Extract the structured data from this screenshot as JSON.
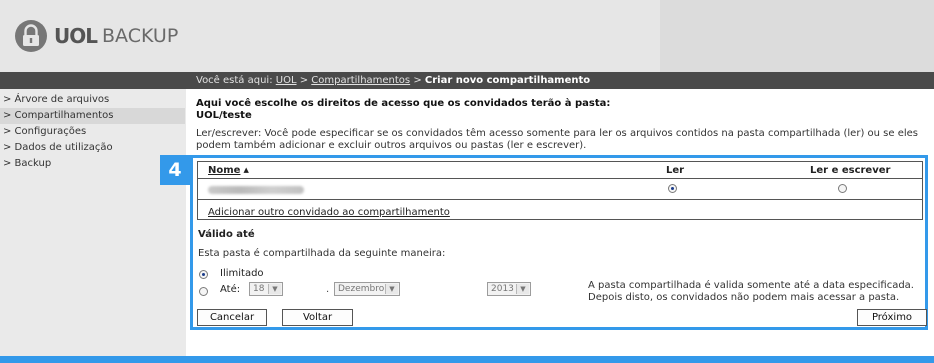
{
  "header": {
    "brand_bold": "UOL",
    "brand_light": "BACKUP"
  },
  "breadcrumb": {
    "prefix": "Você está aqui:",
    "items": [
      "UOL",
      "Compartilhamentos"
    ],
    "separator": ">",
    "current": "Criar novo compartilhamento"
  },
  "sidebar": {
    "items": [
      {
        "label": "> Árvore de arquivos"
      },
      {
        "label": "> Compartilhamentos"
      },
      {
        "label": "> Configurações"
      },
      {
        "label": "> Dados de utilização"
      },
      {
        "label": "> Backup"
      }
    ]
  },
  "main": {
    "intro_line1": "Aqui você escolhe os direitos de acesso que os convidados terão à pasta:",
    "intro_line2": "UOL/teste",
    "description": "Ler/escrever: Você pode especificar se os convidados têm acesso somente para ler os arquivos contidos na pasta compartilhada (ler) ou se eles podem também adicionar e excluir outros arquivos ou pastas (ler e escrever)."
  },
  "step_badge": "4",
  "table": {
    "col_name": "Nome",
    "col_read": "Ler",
    "col_write": "Ler e escrever",
    "rows": [
      {
        "selected": "read"
      }
    ],
    "add_guest": "Adicionar outro convidado ao compartilhamento"
  },
  "validity": {
    "title": "Válido até",
    "share_mode": "Esta pasta é compartilhada da seguinte maneira:",
    "option_unlimited": "Ilimitado",
    "option_until": "Até:",
    "selected": "unlimited",
    "day": "18",
    "month": "Dezembro",
    "year": "2013",
    "date_sep": ".",
    "note": "A pasta compartilhada é valida somente até a data especificada. Depois disto, os convidados não podem mais acessar a pasta."
  },
  "buttons": {
    "cancel": "Cancelar",
    "back": "Voltar",
    "next": "Próximo"
  },
  "colors": {
    "accent": "#3399ea",
    "topbar": "#4a4a4a",
    "sidebar": "#eaeaea"
  }
}
